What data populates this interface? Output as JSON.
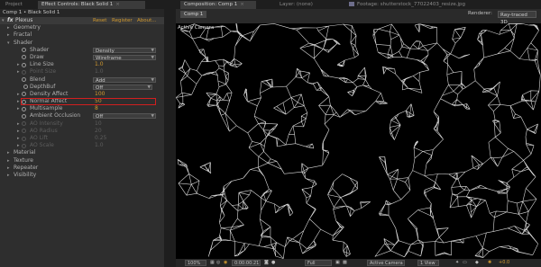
{
  "tabs": {
    "project": "Project",
    "effect_controls": "Effect Controls: Black Solid 1",
    "composition": "Composition: Comp 1",
    "layer": "Layer: (none)",
    "footage": "Footage: shutterstock_77022403_resize.jpg",
    "close": "×"
  },
  "effect_controls": {
    "breadcrumb": "Comp 1 • Black Solid 1",
    "fx_label": "fx",
    "effect_name": "Plexus",
    "reset": "Reset",
    "register": "Register",
    "about": "About...",
    "groups": {
      "geometry": "Geometry",
      "fractal": "Fractal",
      "shader": "Shader",
      "material": "Material",
      "texture": "Texture",
      "repeater": "Repeater",
      "visibility": "Visibility"
    },
    "params": {
      "shader": {
        "label": "Shader",
        "value": "Density"
      },
      "draw": {
        "label": "Draw",
        "value": "Wireframe"
      },
      "line_size": {
        "label": "Line Size",
        "value": "1.0"
      },
      "point_size": {
        "label": "Point Size",
        "value": "1.0"
      },
      "blend": {
        "label": "Blend",
        "value": "Add"
      },
      "depthbuf": {
        "label": "DepthBuf",
        "value": "Off"
      },
      "density_affect": {
        "label": "Density Affect",
        "value": "100"
      },
      "normal_affect": {
        "label": "Normal Affect",
        "value": "50"
      },
      "multisample": {
        "label": "Multisample",
        "value": "8"
      },
      "ambient_occlusion": {
        "label": "Ambient Occlusion",
        "value": "Off"
      },
      "ao_intensity": {
        "label": "AO Intensity",
        "value": "10"
      },
      "ao_radius": {
        "label": "AO Radius",
        "value": "20"
      },
      "ao_lift": {
        "label": "AO Lift",
        "value": "0.25"
      },
      "ao_scale": {
        "label": "AO Scale",
        "value": "1.0"
      }
    }
  },
  "composition": {
    "comp_tab": "Comp 1",
    "renderer_label": "Renderer:",
    "renderer_value": "Ray-traced 3D",
    "active_camera_label": "Active Camera",
    "bottombar": {
      "zoom": "100%",
      "timecode": "0:00:00:21",
      "resolution": "Full",
      "camera": "Active Camera",
      "views": "1 View",
      "exposure": "+0.0"
    }
  },
  "colors": {
    "accent": "#d39a2e",
    "highlight": "#d21f1f",
    "panel": "#2e2e2e",
    "viewer": "#000000"
  },
  "icons": [
    "stopwatch-icon",
    "disclosure-triangle-icon",
    "chevron-down-icon",
    "footage-icon"
  ]
}
